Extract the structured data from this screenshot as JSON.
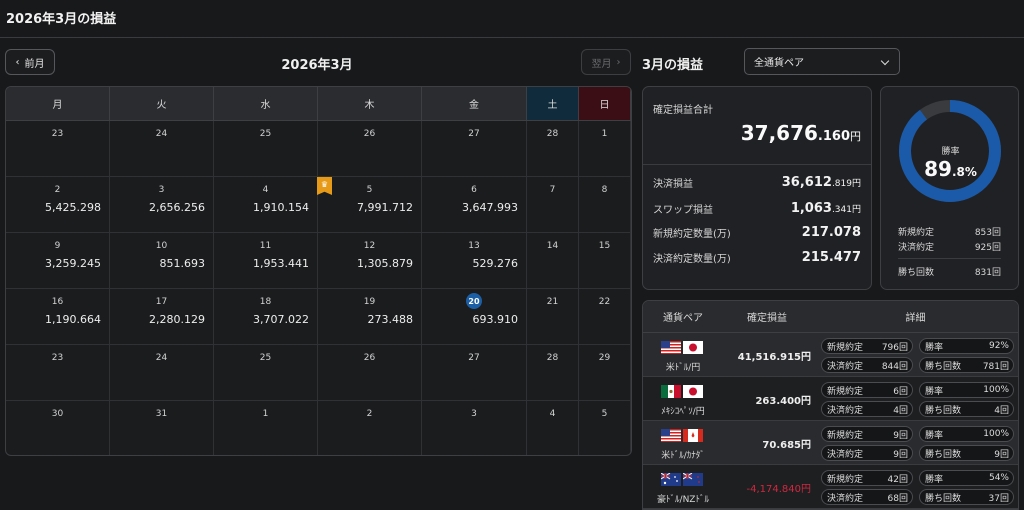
{
  "header": {
    "title": "2026年3月の損益"
  },
  "calendar": {
    "prev_label": "前月",
    "next_label": "翌月",
    "month_title": "2026年3月",
    "weekdays": [
      "月",
      "火",
      "水",
      "木",
      "金",
      "土",
      "日"
    ],
    "weeks": [
      [
        {
          "d": "23",
          "v": ""
        },
        {
          "d": "24",
          "v": ""
        },
        {
          "d": "25",
          "v": ""
        },
        {
          "d": "26",
          "v": ""
        },
        {
          "d": "27",
          "v": ""
        },
        {
          "d": "28",
          "v": ""
        },
        {
          "d": "1",
          "v": ""
        }
      ],
      [
        {
          "d": "2",
          "v": "5,425.298"
        },
        {
          "d": "3",
          "v": "2,656.256"
        },
        {
          "d": "4",
          "v": "1,910.154"
        },
        {
          "d": "5",
          "v": "7,991.712"
        },
        {
          "d": "6",
          "v": "3,647.993"
        },
        {
          "d": "7",
          "v": ""
        },
        {
          "d": "8",
          "v": ""
        }
      ],
      [
        {
          "d": "9",
          "v": "3,259.245"
        },
        {
          "d": "10",
          "v": "851.693"
        },
        {
          "d": "11",
          "v": "1,953.441"
        },
        {
          "d": "12",
          "v": "1,305.879"
        },
        {
          "d": "13",
          "v": "529.276"
        },
        {
          "d": "14",
          "v": ""
        },
        {
          "d": "15",
          "v": ""
        }
      ],
      [
        {
          "d": "16",
          "v": "1,190.664"
        },
        {
          "d": "17",
          "v": "2,280.129"
        },
        {
          "d": "18",
          "v": "3,707.022"
        },
        {
          "d": "19",
          "v": "273.488"
        },
        {
          "d": "20",
          "v": "693.910"
        },
        {
          "d": "21",
          "v": ""
        },
        {
          "d": "22",
          "v": ""
        }
      ],
      [
        {
          "d": "23",
          "v": ""
        },
        {
          "d": "24",
          "v": ""
        },
        {
          "d": "25",
          "v": ""
        },
        {
          "d": "26",
          "v": ""
        },
        {
          "d": "27",
          "v": ""
        },
        {
          "d": "28",
          "v": ""
        },
        {
          "d": "29",
          "v": ""
        }
      ],
      [
        {
          "d": "30",
          "v": ""
        },
        {
          "d": "31",
          "v": ""
        },
        {
          "d": "1",
          "v": ""
        },
        {
          "d": "2",
          "v": ""
        },
        {
          "d": "3",
          "v": ""
        },
        {
          "d": "4",
          "v": ""
        },
        {
          "d": "5",
          "v": ""
        }
      ]
    ],
    "today": "20",
    "best_day": "5"
  },
  "panel": {
    "title": "3月の損益",
    "pair_select": "全通貨ペア",
    "summary": {
      "total_label": "確定損益合計",
      "total_int": "37,676",
      "total_dec": ".160",
      "yen": "円",
      "rows": [
        {
          "label": "決済損益",
          "int": "36,612",
          "dec": ".819",
          "unit": "円"
        },
        {
          "label": "スワップ損益",
          "int": "1,063",
          "dec": ".341",
          "unit": "円"
        },
        {
          "label": "新規約定数量(万)",
          "int": "217.078",
          "dec": "",
          "unit": ""
        },
        {
          "label": "決済約定数量(万)",
          "int": "215.477",
          "dec": "",
          "unit": ""
        }
      ]
    },
    "winrate": {
      "label": "勝率",
      "int": "89",
      "dec": ".8%",
      "value": 0.898,
      "ring_color": "#1a5aa8",
      "track_color": "#3a3b3f",
      "stats": [
        {
          "label": "新規約定",
          "value": "853回"
        },
        {
          "label": "決済約定",
          "value": "925回"
        },
        {
          "label": "勝ち回数",
          "value": "831回"
        }
      ]
    }
  },
  "table": {
    "headers": [
      "通貨ペア",
      "確定損益",
      "詳細"
    ],
    "rows": [
      {
        "pair": "米ﾄﾞﾙ/円",
        "flags": [
          "us",
          "jp"
        ],
        "pl": "41,516.915円",
        "neg": false,
        "new_label": "新規約定",
        "new": "796回",
        "close_label": "決済約定",
        "close": "844回",
        "win_label": "勝率",
        "win": "92%",
        "wins_label": "勝ち回数",
        "wins": "781回"
      },
      {
        "pair": "ﾒｷｼｺﾍﾟｿ/円",
        "flags": [
          "mx",
          "jp"
        ],
        "pl": "263.400円",
        "neg": false,
        "new_label": "新規約定",
        "new": "6回",
        "close_label": "決済約定",
        "close": "4回",
        "win_label": "勝率",
        "win": "100%",
        "wins_label": "勝ち回数",
        "wins": "4回"
      },
      {
        "pair": "米ﾄﾞﾙ/ｶﾅﾀﾞ",
        "flags": [
          "us",
          "ca"
        ],
        "pl": "70.685円",
        "neg": false,
        "new_label": "新規約定",
        "new": "9回",
        "close_label": "決済約定",
        "close": "9回",
        "win_label": "勝率",
        "win": "100%",
        "wins_label": "勝ち回数",
        "wins": "9回"
      },
      {
        "pair": "豪ﾄﾞﾙ/NZﾄﾞﾙ",
        "flags": [
          "au",
          "nz"
        ],
        "pl": "-4,174.840円",
        "neg": true,
        "new_label": "新規約定",
        "new": "42回",
        "close_label": "決済約定",
        "close": "68回",
        "win_label": "勝率",
        "win": "54%",
        "wins_label": "勝ち回数",
        "wins": "37回"
      }
    ]
  }
}
